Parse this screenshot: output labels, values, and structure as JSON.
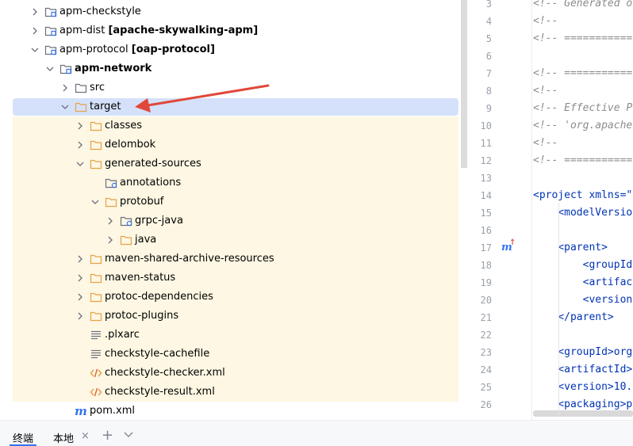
{
  "tree": {
    "rows": [
      {
        "label": "apm-checkstyle",
        "suffix": ""
      },
      {
        "label": "apm-dist",
        "suffix": "[apache-skywalking-apm]"
      },
      {
        "label": "apm-protocol",
        "suffix": "[oap-protocol]"
      },
      {
        "label": "apm-network",
        "suffix": ""
      },
      {
        "label": "src",
        "suffix": ""
      },
      {
        "label": "target",
        "suffix": ""
      },
      {
        "label": "classes",
        "suffix": ""
      },
      {
        "label": "delombok",
        "suffix": ""
      },
      {
        "label": "generated-sources",
        "suffix": ""
      },
      {
        "label": "annotations",
        "suffix": ""
      },
      {
        "label": "protobuf",
        "suffix": ""
      },
      {
        "label": "grpc-java",
        "suffix": ""
      },
      {
        "label": "java",
        "suffix": ""
      },
      {
        "label": "maven-shared-archive-resources",
        "suffix": ""
      },
      {
        "label": "maven-status",
        "suffix": ""
      },
      {
        "label": "protoc-dependencies",
        "suffix": ""
      },
      {
        "label": "protoc-plugins",
        "suffix": ""
      },
      {
        "label": ".plxarc",
        "suffix": ""
      },
      {
        "label": "checkstyle-cachefile",
        "suffix": ""
      },
      {
        "label": "checkstyle-checker.xml",
        "suffix": ""
      },
      {
        "label": "checkstyle-result.xml",
        "suffix": ""
      },
      {
        "label": "pom.xml",
        "suffix": ""
      }
    ],
    "pom_icon_letter": "m"
  },
  "editor": {
    "line_numbers": [
      "3",
      "4",
      "5",
      "6",
      "7",
      "8",
      "9",
      "10",
      "11",
      "12",
      "13",
      "14",
      "15",
      "16",
      "17",
      "18",
      "19",
      "20",
      "21",
      "22",
      "23",
      "24",
      "25",
      "26"
    ],
    "lines": [
      "<!-- Generated o",
      "<!--",
      "<!-- ===========",
      "",
      "<!-- ===========",
      "<!--",
      "<!-- Effective P",
      "<!-- 'org.apache",
      "<!--",
      "<!-- ===========",
      "",
      "<project xmlns=\"",
      "    <modelVersio",
      "",
      "    <parent>",
      "        <groupId",
      "        <artifac",
      "        <version",
      "    </parent>",
      "",
      "    <groupId>org",
      "    <artifactId>",
      "    <version>10.",
      "    <packaging>p"
    ],
    "gutter_marker": "m",
    "gutter_marker_arrow": "↑"
  },
  "bottombar": {
    "tab_terminal": "终端",
    "tab_local": "本地",
    "close_glyph": "×",
    "add_glyph": "+",
    "dropdown_glyph": "⌄"
  },
  "colors": {
    "selection": "#d5e1fb",
    "excluded": "#fdf7e3",
    "annotation_arrow": "#e0483a",
    "folder_orange": "#e6a349",
    "folder_gray": "#6c707e",
    "accent_blue": "#3574f0"
  }
}
